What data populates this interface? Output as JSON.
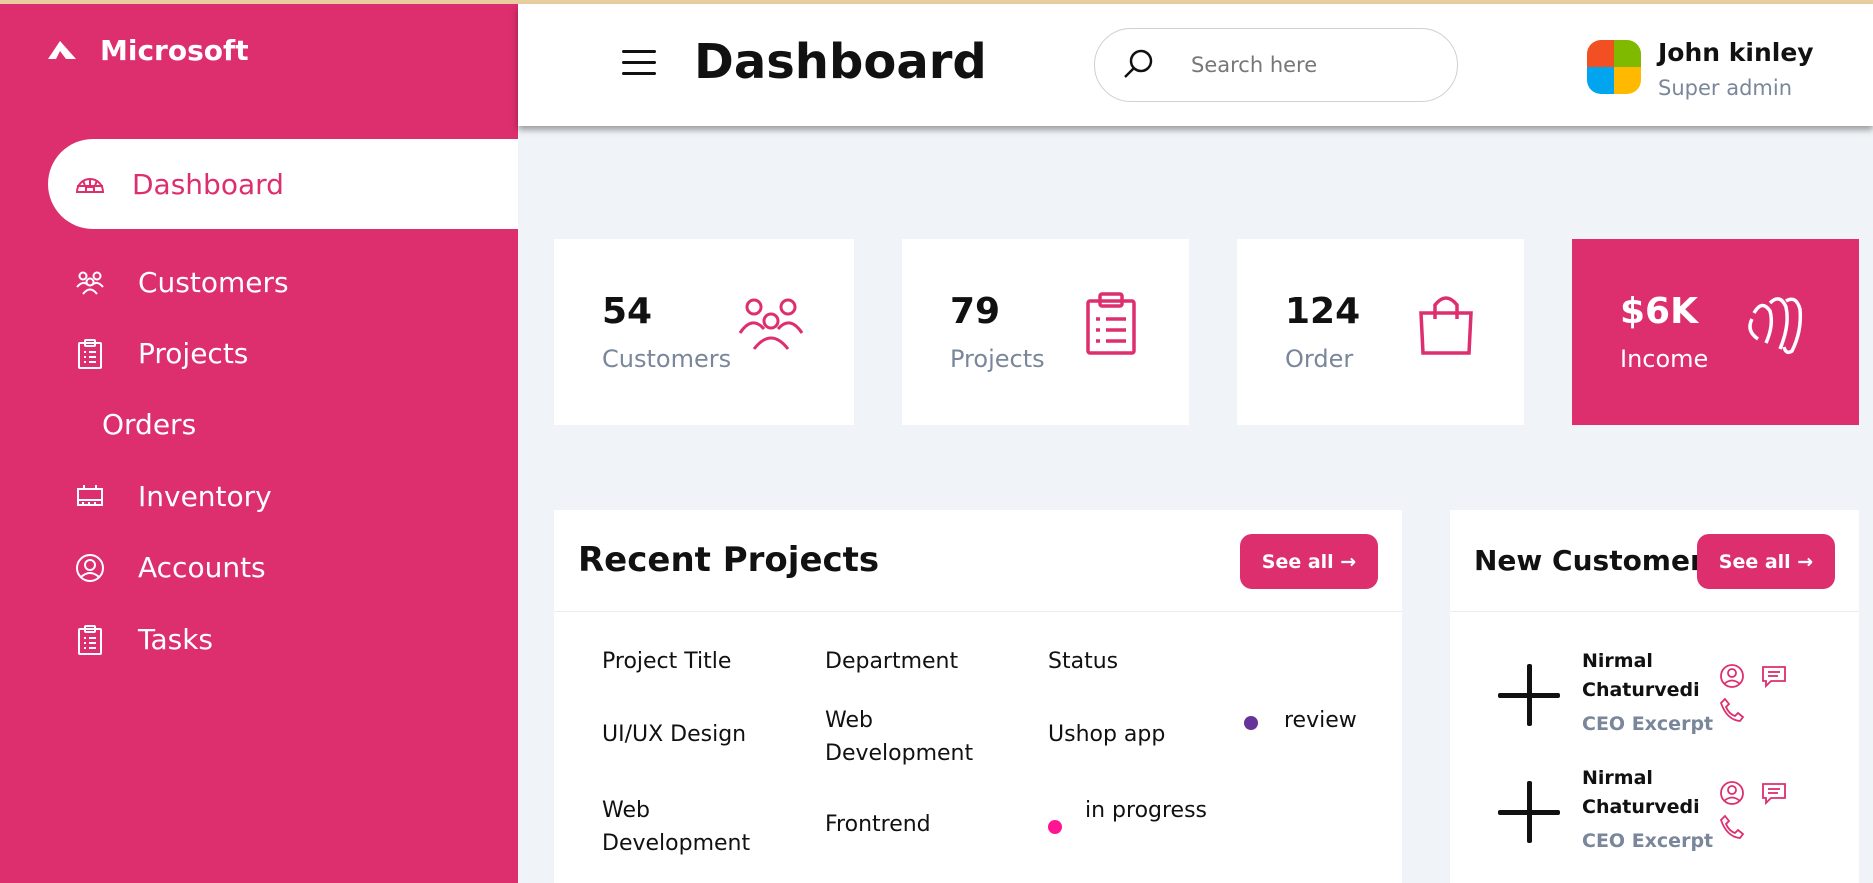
{
  "brand": {
    "name": "Microsoft"
  },
  "colors": {
    "accent": "#dd2e6e",
    "muted": "#7a869a",
    "background": "#f0f3f7"
  },
  "sidebar": {
    "items": [
      {
        "label": "Dashboard",
        "icon": "igloo-icon",
        "active": true
      },
      {
        "label": "Customers",
        "icon": "people-icon"
      },
      {
        "label": "Projects",
        "icon": "clipboard-icon"
      },
      {
        "label": "Orders",
        "icon": ""
      },
      {
        "label": "Inventory",
        "icon": "inventory-icon"
      },
      {
        "label": "Accounts",
        "icon": "user-circle-icon"
      },
      {
        "label": "Tasks",
        "icon": "clipboard-icon"
      }
    ]
  },
  "header": {
    "title": "Dashboard",
    "search_placeholder": "Search here",
    "user": {
      "name": "John kinley",
      "role": "Super admin"
    }
  },
  "cards": [
    {
      "value": "54",
      "label": "Customers",
      "icon": "people-icon"
    },
    {
      "value": "79",
      "label": "Projects",
      "icon": "clipboard-icon"
    },
    {
      "value": "124",
      "label": "Order",
      "icon": "shopping-bag-icon"
    },
    {
      "value": "$6K",
      "label": "Income",
      "icon": "money-icon"
    }
  ],
  "recent_projects": {
    "title": "Recent Projects",
    "see_all": "See all →",
    "headers": [
      "Project Title",
      "Department",
      "Status"
    ],
    "rows": [
      {
        "title": "UI/UX Design",
        "department": "Web Development",
        "status": "Ushop app",
        "tag": "review",
        "tag_color": "#663399"
      },
      {
        "title": "Web Development",
        "department": "Frontrend",
        "status": "",
        "tag": "in progress",
        "tag_color": "#ff1493"
      }
    ]
  },
  "new_customer": {
    "title": "New Customer",
    "see_all": "See all →",
    "customers": [
      {
        "name": "Nirmal Chaturvedi",
        "role": "CEO Excerpt"
      },
      {
        "name": "Nirmal Chaturvedi",
        "role": "CEO Excerpt"
      }
    ]
  }
}
